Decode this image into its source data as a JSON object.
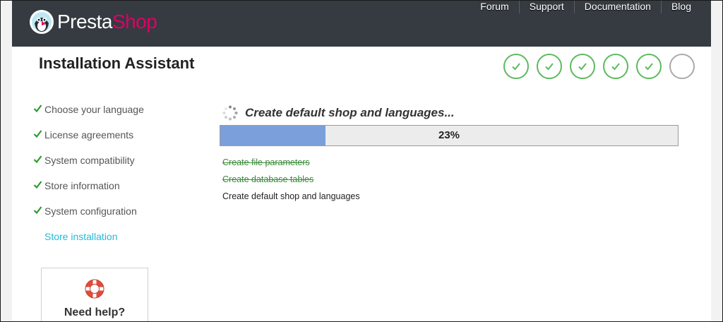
{
  "brand": {
    "name_part1": "Presta",
    "name_part2": "Shop",
    "accent_color": "#df0067"
  },
  "topnav": {
    "items": [
      "Forum",
      "Support",
      "Documentation",
      "Blog"
    ]
  },
  "page_title": "Installation Assistant",
  "steps_progress": {
    "completed": 5,
    "total": 6
  },
  "sidebar": {
    "items": [
      {
        "label": "Choose your language",
        "state": "done"
      },
      {
        "label": "License agreements",
        "state": "done"
      },
      {
        "label": "System compatibility",
        "state": "done"
      },
      {
        "label": "Store information",
        "state": "done"
      },
      {
        "label": "System configuration",
        "state": "done"
      },
      {
        "label": "Store installation",
        "state": "current"
      }
    ],
    "help_label": "Need help?"
  },
  "main": {
    "status_text": "Create default shop and languages...",
    "progress_percent": 23,
    "progress_label": "23%",
    "tasks": [
      {
        "label": "Create file parameters",
        "state": "done"
      },
      {
        "label": "Create database tables",
        "state": "done"
      },
      {
        "label": "Create default shop and languages",
        "state": "in-progress"
      }
    ]
  },
  "colors": {
    "header_bg": "#363a41",
    "check_green": "#5cba5c",
    "current_step_blue": "#25b9d7",
    "progress_fill": "#7b9fdb"
  },
  "icons": {
    "logo": "puffin-logo-icon",
    "step_done": "check-circle-icon",
    "step_pending": "empty-circle-icon",
    "sidebar_done": "check-icon",
    "help": "life-ring-icon",
    "loading": "spinner-icon"
  }
}
